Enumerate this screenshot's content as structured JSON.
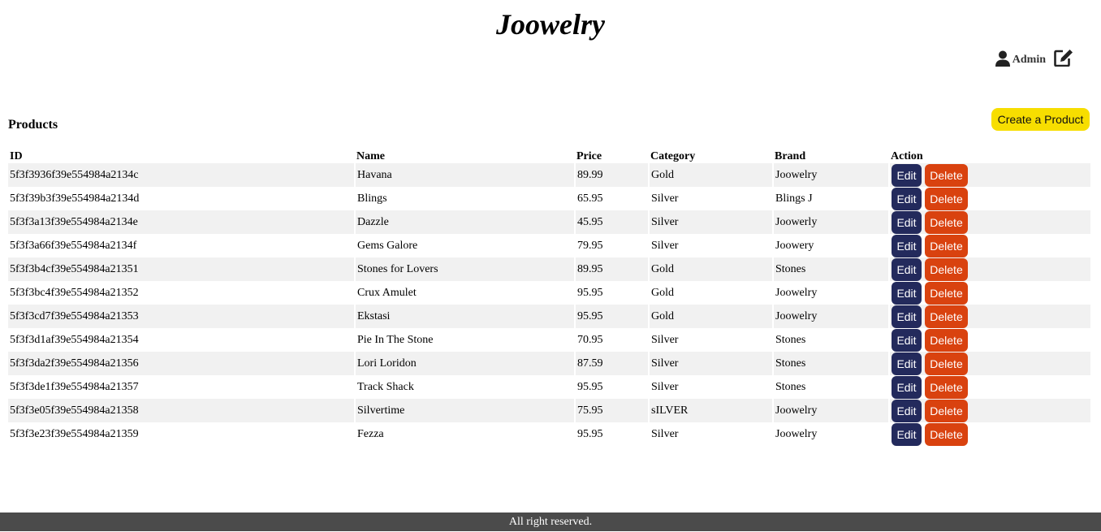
{
  "header": {
    "brand": "Joowelry",
    "user_label": "Admin"
  },
  "icons": {
    "user": "user-icon",
    "edit_profile": "edit-profile-icon"
  },
  "products_section": {
    "title": "Products",
    "create_label": "Create a Product"
  },
  "table": {
    "columns": [
      "ID",
      "Name",
      "Price",
      "Category",
      "Brand",
      "Action"
    ],
    "rows": [
      {
        "id": "5f3f3936f39e554984a2134c",
        "name": "Havana",
        "price": "89.99",
        "category": "Gold",
        "brand": "Joowelry"
      },
      {
        "id": "5f3f39b3f39e554984a2134d",
        "name": "Blings",
        "price": "65.95",
        "category": "Silver",
        "brand": "Blings J"
      },
      {
        "id": "5f3f3a13f39e554984a2134e",
        "name": "Dazzle",
        "price": "45.95",
        "category": "Silver",
        "brand": "Joowerly"
      },
      {
        "id": "5f3f3a66f39e554984a2134f",
        "name": "Gems Galore",
        "price": "79.95",
        "category": "Silver",
        "brand": "Joowery"
      },
      {
        "id": "5f3f3b4cf39e554984a21351",
        "name": "Stones for Lovers",
        "price": "89.95",
        "category": "Gold",
        "brand": "Stones"
      },
      {
        "id": "5f3f3bc4f39e554984a21352",
        "name": "Crux Amulet",
        "price": "95.95",
        "category": "Gold",
        "brand": "Joowelry"
      },
      {
        "id": "5f3f3cd7f39e554984a21353",
        "name": "Ekstasi",
        "price": "95.95",
        "category": "Gold",
        "brand": "Joowelry"
      },
      {
        "id": "5f3f3d1af39e554984a21354",
        "name": "Pie In The Stone",
        "price": "70.95",
        "category": "Silver",
        "brand": "Stones"
      },
      {
        "id": "5f3f3da2f39e554984a21356",
        "name": "Lori Loridon",
        "price": "87.59",
        "category": "Silver",
        "brand": "Stones"
      },
      {
        "id": "5f3f3de1f39e554984a21357",
        "name": "Track Shack",
        "price": "95.95",
        "category": "Silver",
        "brand": "Stones"
      },
      {
        "id": "5f3f3e05f39e554984a21358",
        "name": "Silvertime",
        "price": "75.95",
        "category": "sILVER",
        "brand": "Joowelry"
      },
      {
        "id": "5f3f3e23f39e554984a21359",
        "name": "Fezza",
        "price": "95.95",
        "category": "Silver",
        "brand": "Joowelry"
      }
    ],
    "edit_label": "Edit",
    "delete_label": "Delete"
  },
  "footer": {
    "text": "All right reserved."
  },
  "colors": {
    "create_button": "#f7de00",
    "edit_button": "#232a5c",
    "delete_button": "#d9420f",
    "row_stripe": "#f1f1f1",
    "footer_bg": "#4b4b4b"
  }
}
